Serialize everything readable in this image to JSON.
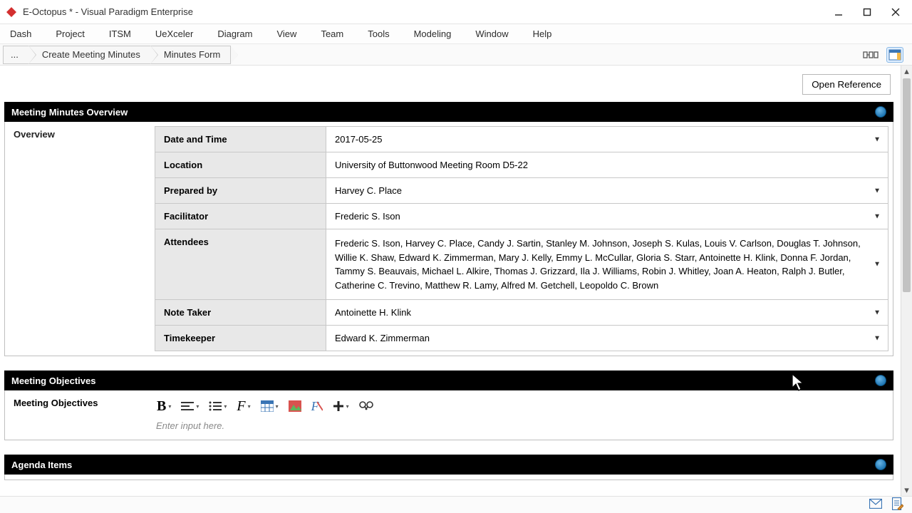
{
  "window": {
    "title": "E-Octopus * - Visual Paradigm Enterprise"
  },
  "menu": [
    "Dash",
    "Project",
    "ITSM",
    "UeXceler",
    "Diagram",
    "View",
    "Team",
    "Tools",
    "Modeling",
    "Window",
    "Help"
  ],
  "breadcrumbs": [
    "...",
    "Create Meeting Minutes",
    "Minutes Form"
  ],
  "open_reference_label": "Open Reference",
  "sections": {
    "overview_header": "Meeting Minutes Overview",
    "overview_side_label": "Overview",
    "objectives_header": "Meeting Objectives",
    "objectives_side_label": "Meeting Objectives",
    "agenda_header": "Agenda Items",
    "editor_placeholder": "Enter input here."
  },
  "overview": {
    "date_label": "Date and Time",
    "date_value": "2017-05-25",
    "location_label": "Location",
    "location_value": "University of Buttonwood Meeting Room D5-22",
    "prepared_label": "Prepared by",
    "prepared_value": "Harvey C. Place",
    "facilitator_label": "Facilitator",
    "facilitator_value": "Frederic S. Ison",
    "attendees_label": "Attendees",
    "attendees_value": "Frederic S. Ison, Harvey C. Place, Candy J. Sartin, Stanley M. Johnson, Joseph S. Kulas, Louis V. Carlson, Douglas T. Johnson, Willie K. Shaw, Edward K. Zimmerman, Mary J. Kelly, Emmy L. McCullar, Gloria S. Starr, Antoinette H. Klink, Donna F. Jordan, Tammy S. Beauvais, Michael L. Alkire, Thomas J. Grizzard, Ila J. Williams, Robin J. Whitley, Joan A. Heaton, Ralph J. Butler, Catherine C. Trevino, Matthew R. Lamy, Alfred M. Getchell, Leopoldo C. Brown",
    "notetaker_label": "Note Taker",
    "notetaker_value": "Antoinette H. Klink",
    "timekeeper_label": "Timekeeper",
    "timekeeper_value": "Edward K. Zimmerman"
  }
}
